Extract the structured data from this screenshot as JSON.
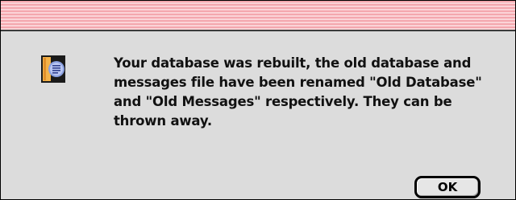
{
  "dialog": {
    "icon": "alert-note-icon",
    "message": "Your database was rebuilt, the old database and messages file have been renamed \"Old Database\" and \"Old Messages\" respectively. They can be thrown away.",
    "ok_label": "OK"
  },
  "colors": {
    "title_stripe_dark": "#f4a7ae",
    "title_stripe_light": "#fbd3d7",
    "dialog_background": "#dcdcdc"
  }
}
